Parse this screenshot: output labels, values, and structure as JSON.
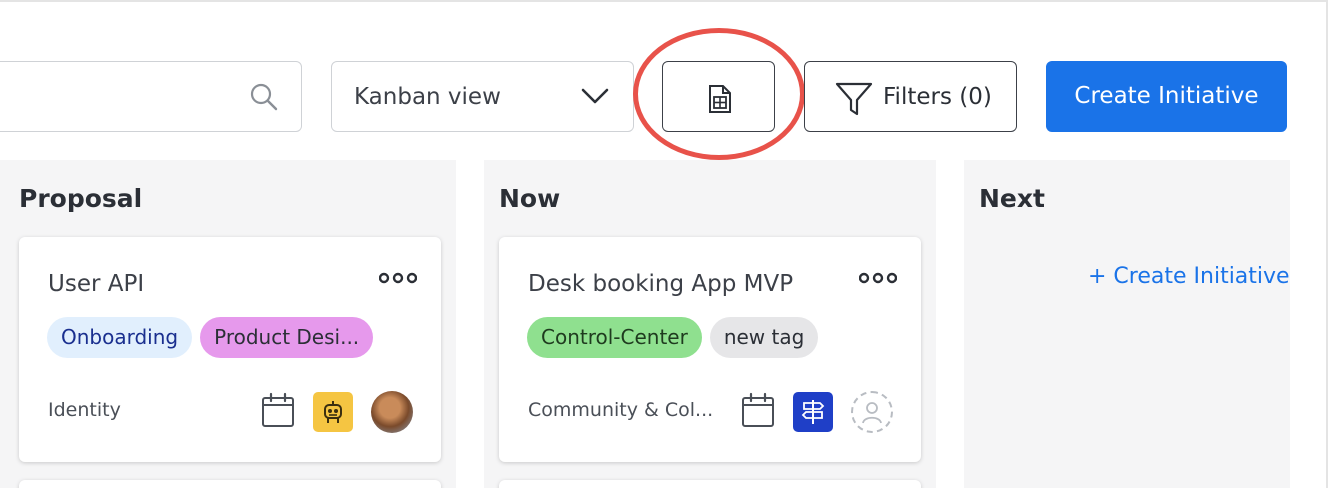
{
  "toolbar": {
    "search": {
      "value": "",
      "placeholder": ""
    },
    "view_select": {
      "selected": "Kanban view"
    },
    "filters_label": "Filters (0)",
    "create_label": "Create Initiative"
  },
  "columns": [
    {
      "title": "Proposal",
      "card": {
        "title": "User API",
        "tags": [
          {
            "label": "Onboarding",
            "bg": "#e1effd",
            "fg": "#1a2f8f"
          },
          {
            "label": "Product Desi...",
            "bg": "#e699ec",
            "fg": "#2b2f36"
          }
        ],
        "team": "Identity"
      }
    },
    {
      "title": "Now",
      "card": {
        "title": "Desk booking App MVP",
        "tags": [
          {
            "label": "Control-Center",
            "bg": "#8fe08f",
            "fg": "#1f3b1f"
          },
          {
            "label": "new tag",
            "bg": "#e6e6e8",
            "fg": "#2b2f36"
          }
        ],
        "team": "Community & Col..."
      }
    },
    {
      "title": "Next",
      "create_link": "+ Create Initiative"
    }
  ],
  "colors": {
    "accent": "#1a73e8",
    "highlight_ring": "#e8524a",
    "robot_badge": "#f5c542",
    "roadmap_badge": "#1f3fc7"
  },
  "icons": [
    "search-icon",
    "chevron-down-icon",
    "spreadsheet-icon",
    "filter-icon",
    "more-icon",
    "calendar-icon",
    "robot-icon",
    "signpost-icon",
    "user-placeholder-icon"
  ]
}
